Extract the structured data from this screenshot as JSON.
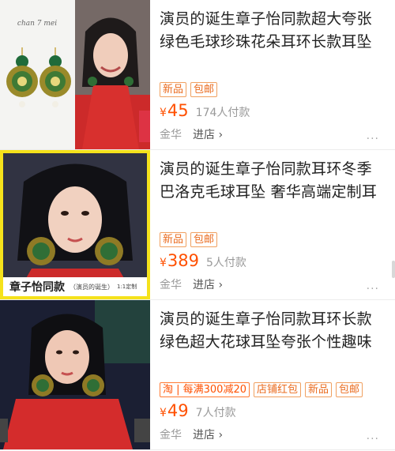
{
  "colors": {
    "price": "#ff5000",
    "tag_border": "#f0a060",
    "highlight_frame": "#f5e21b"
  },
  "products": [
    {
      "title": "演员的诞生章子怡同款超大夸张绿色毛球珍珠花朵耳环长款耳坠",
      "tags": [
        "新品",
        "包邮"
      ],
      "currency": "¥",
      "price": "45",
      "sold": "174人付款",
      "location": "金华",
      "enter_shop": "进店 ›",
      "more": "···",
      "image_text": "chan 7 mei"
    },
    {
      "title": "演员的诞生章子怡同款耳环冬季巴洛克毛球耳坠 奢华高端定制耳",
      "tags": [
        "新品",
        "包邮"
      ],
      "currency": "¥",
      "price": "389",
      "sold": "5人付款",
      "location": "金华",
      "enter_shop": "进店 ›",
      "more": "···",
      "caption_main": "章子怡同款",
      "caption_sub": "（演员的诞生）",
      "caption_note": "1:1定制"
    },
    {
      "title": "演员的诞生章子怡同款耳环长款绿色超大花球耳坠夸张个性趣味",
      "tags": [
        "淘 | 每满300减20",
        "店铺红包",
        "新品",
        "包邮"
      ],
      "currency": "¥",
      "price": "49",
      "sold": "7人付款",
      "location": "金华",
      "enter_shop": "进店 ›",
      "more": "···"
    }
  ]
}
